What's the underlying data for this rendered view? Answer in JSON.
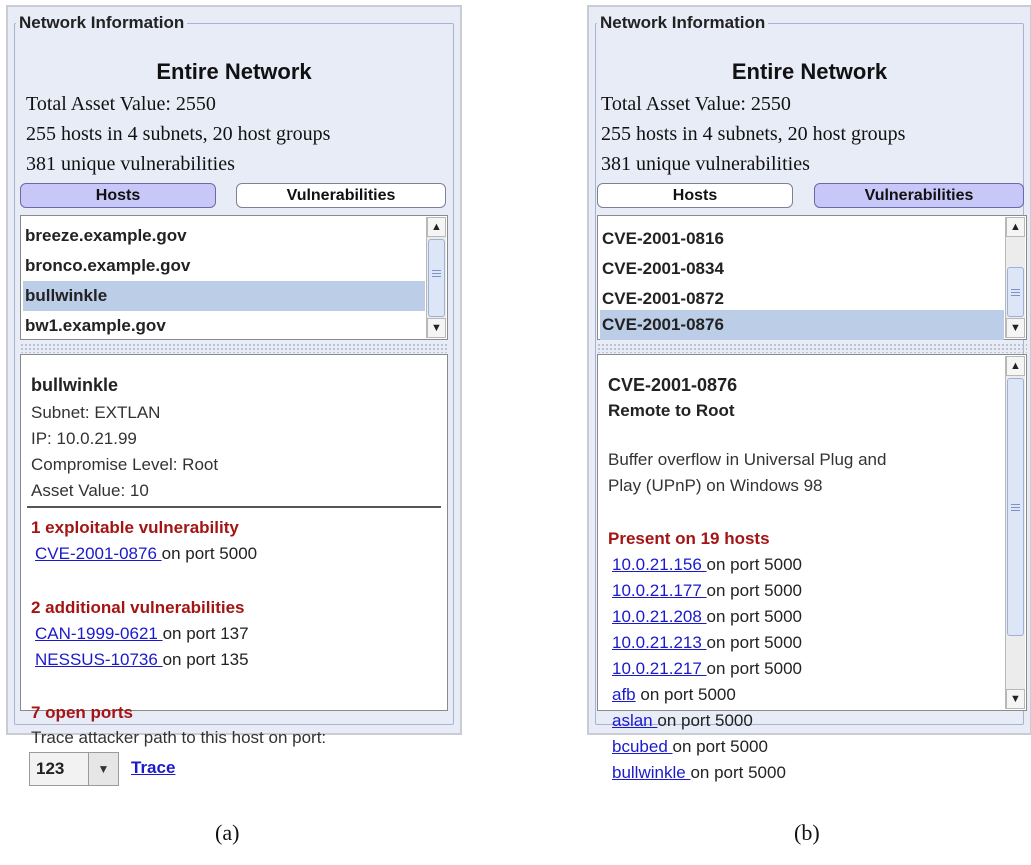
{
  "panel_a": {
    "legend": "Network Information",
    "title": "Entire Network",
    "summary": [
      "Total Asset Value: 2550",
      "255 hosts in 4 subnets, 20 host groups",
      "381 unique vulnerabilities"
    ],
    "tabs": {
      "hosts": "Hosts",
      "vulns": "Vulnerabilities",
      "active": "hosts"
    },
    "list": [
      "breeze.example.gov",
      "bronco.example.gov",
      "bullwinkle",
      "bw1.example.gov"
    ],
    "selected_index": 2,
    "detail": {
      "name": "bullwinkle",
      "subnet": "Subnet: EXTLAN",
      "ip": "IP: 10.0.21.99",
      "compromise": "Compromise Level: Root",
      "asset": "Asset Value: 10",
      "exploitable_heading": "1 exploitable vulnerability",
      "exploitable": [
        {
          "link": "CVE-2001-0876 ",
          "port": "on port 5000"
        }
      ],
      "additional_heading": "2 additional vulnerabilities",
      "additional": [
        {
          "link": "CAN-1999-0621 ",
          "port": "on port 137"
        },
        {
          "link": "NESSUS-10736 ",
          "port": "on port 135"
        }
      ],
      "ports_heading": "7 open ports",
      "trace_prompt": "Trace attacker path to this host on port:",
      "port_value": "123",
      "trace_label": "Trace"
    },
    "caption": "(a)"
  },
  "panel_b": {
    "legend": "Network Information",
    "title": "Entire Network",
    "summary": [
      "Total Asset Value: 2550",
      "255 hosts in 4 subnets, 20 host groups",
      "381 unique vulnerabilities"
    ],
    "tabs": {
      "hosts": "Hosts",
      "vulns": "Vulnerabilities",
      "active": "vulns"
    },
    "list": [
      "CVE-2001-0816",
      "CVE-2001-0834",
      "CVE-2001-0872",
      "CVE-2001-0876"
    ],
    "selected_index": 3,
    "detail": {
      "name": "CVE-2001-0876",
      "type": "Remote to Root",
      "description": [
        "Buffer overflow in Universal Plug and",
        "Play (UPnP) on Windows 98"
      ],
      "present_heading": "Present on 19 hosts",
      "hosts": [
        {
          "link": "10.0.21.156 ",
          "port": "on port 5000"
        },
        {
          "link": "10.0.21.177 ",
          "port": "on port 5000"
        },
        {
          "link": "10.0.21.208 ",
          "port": "on port 5000"
        },
        {
          "link": "10.0.21.213 ",
          "port": "on port 5000"
        },
        {
          "link": "10.0.21.217 ",
          "port": "on port 5000"
        },
        {
          "link": "afb",
          "port": " on port 5000"
        },
        {
          "link": "aslan ",
          "port": "on port 5000"
        },
        {
          "link": "bcubed ",
          "port": "on port 5000"
        },
        {
          "link": "bullwinkle ",
          "port": "on port 5000"
        }
      ]
    },
    "caption": "(b)"
  },
  "icons": {
    "scroll_up": "scroll-up-arrow-icon",
    "scroll_down": "scroll-down-arrow-icon",
    "thumb_grip": "scroll-grip-icon",
    "dropdown": "dropdown-arrow-icon"
  }
}
